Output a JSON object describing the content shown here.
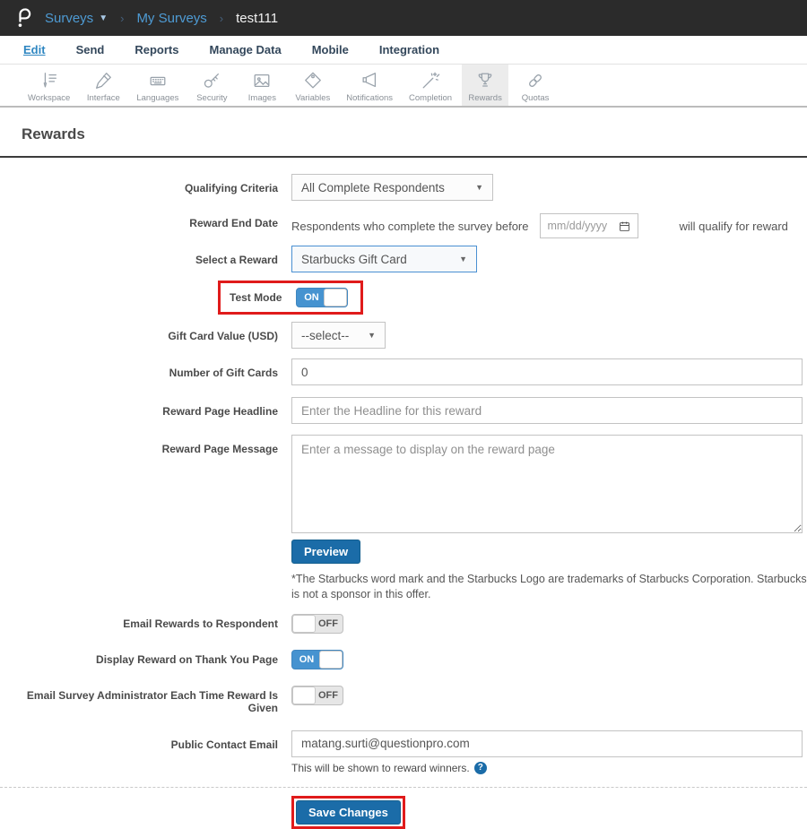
{
  "header": {
    "breadcrumb": {
      "surveys": "Surveys",
      "my_surveys": "My Surveys",
      "survey_name": "test111"
    }
  },
  "tabs": [
    {
      "label": "Edit",
      "active": true
    },
    {
      "label": "Send"
    },
    {
      "label": "Reports"
    },
    {
      "label": "Manage Data"
    },
    {
      "label": "Mobile"
    },
    {
      "label": "Integration"
    }
  ],
  "toolbar": {
    "items": [
      {
        "label": "Workspace",
        "icon": "pen-list-icon"
      },
      {
        "label": "Interface",
        "icon": "pen-icon"
      },
      {
        "label": "Languages",
        "icon": "keyboard-icon"
      },
      {
        "label": "Security",
        "icon": "key-icon"
      },
      {
        "label": "Images",
        "icon": "image-icon"
      },
      {
        "label": "Variables",
        "icon": "tag-icon"
      },
      {
        "label": "Notifications",
        "icon": "megaphone-icon"
      },
      {
        "label": "Completion",
        "icon": "magic-wand-icon"
      },
      {
        "label": "Rewards",
        "icon": "trophy-icon",
        "selected": true
      },
      {
        "label": "Quotas",
        "icon": "chain-link-icon"
      }
    ]
  },
  "page": {
    "title": "Rewards"
  },
  "form": {
    "qualifying_criteria": {
      "label": "Qualifying Criteria",
      "value": "All Complete Respondents"
    },
    "reward_end_date": {
      "label": "Reward End Date",
      "prefix": "Respondents who complete the survey before",
      "placeholder": "mm/dd/yyyy",
      "suffix": "will qualify for reward"
    },
    "select_reward": {
      "label": "Select a Reward",
      "value": "Starbucks Gift Card"
    },
    "test_mode": {
      "label": "Test Mode",
      "state": "ON"
    },
    "gift_card_value": {
      "label": "Gift Card Value (USD)",
      "value": "--select--"
    },
    "num_gift_cards": {
      "label": "Number of Gift Cards",
      "value": "0"
    },
    "headline": {
      "label": "Reward Page Headline",
      "placeholder": "Enter the Headline for this reward"
    },
    "message": {
      "label": "Reward Page Message",
      "placeholder": "Enter a message to display on the reward page"
    },
    "preview_button": "Preview",
    "disclaimer": "*The Starbucks word mark and the Starbucks Logo are trademarks of Starbucks Corporation. Starbucks is not a sponsor in this offer.",
    "email_rewards": {
      "label": "Email Rewards to Respondent",
      "state": "OFF"
    },
    "display_reward": {
      "label": "Display Reward on Thank You Page",
      "state": "ON"
    },
    "email_admin": {
      "label": "Email Survey Administrator Each Time Reward Is Given",
      "state": "OFF"
    },
    "public_email": {
      "label": "Public Contact Email",
      "value": "matang.surti@questionpro.com",
      "helper": "This will be shown to reward winners."
    },
    "save_button": "Save Changes"
  },
  "colors": {
    "header_bg": "#2b2b2b",
    "link_blue": "#4e9bd4",
    "button_blue": "#1b6ca8",
    "toggle_blue": "#4693d0",
    "highlight_red": "#e01b1b"
  }
}
